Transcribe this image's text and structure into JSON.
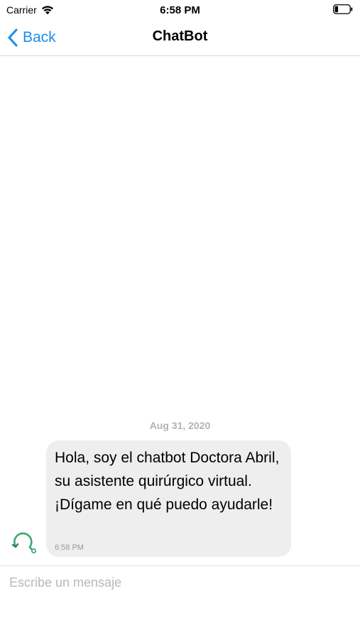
{
  "status_bar": {
    "carrier": "Carrier",
    "time": "6:58 PM",
    "wifi_icon": "wifi-icon",
    "battery_icon": "battery-low-icon"
  },
  "nav": {
    "back_label": "Back",
    "title": "ChatBot",
    "back_icon": "chevron-left-icon",
    "accent_color": "#1a8cf0"
  },
  "chat": {
    "date": "Aug 31, 2020",
    "messages": [
      {
        "sender": "bot",
        "text": "Hola, soy el chatbot Doctora Abril, su asistente quirúrgico virtual. ¡Dígame en qué puedo ayudarle!",
        "time": "6:58 PM",
        "avatar_icon": "bot-avatar-icon",
        "avatar_color": "#3aaa6e"
      }
    ]
  },
  "composer": {
    "placeholder": "Escribe un mensaje",
    "value": ""
  }
}
